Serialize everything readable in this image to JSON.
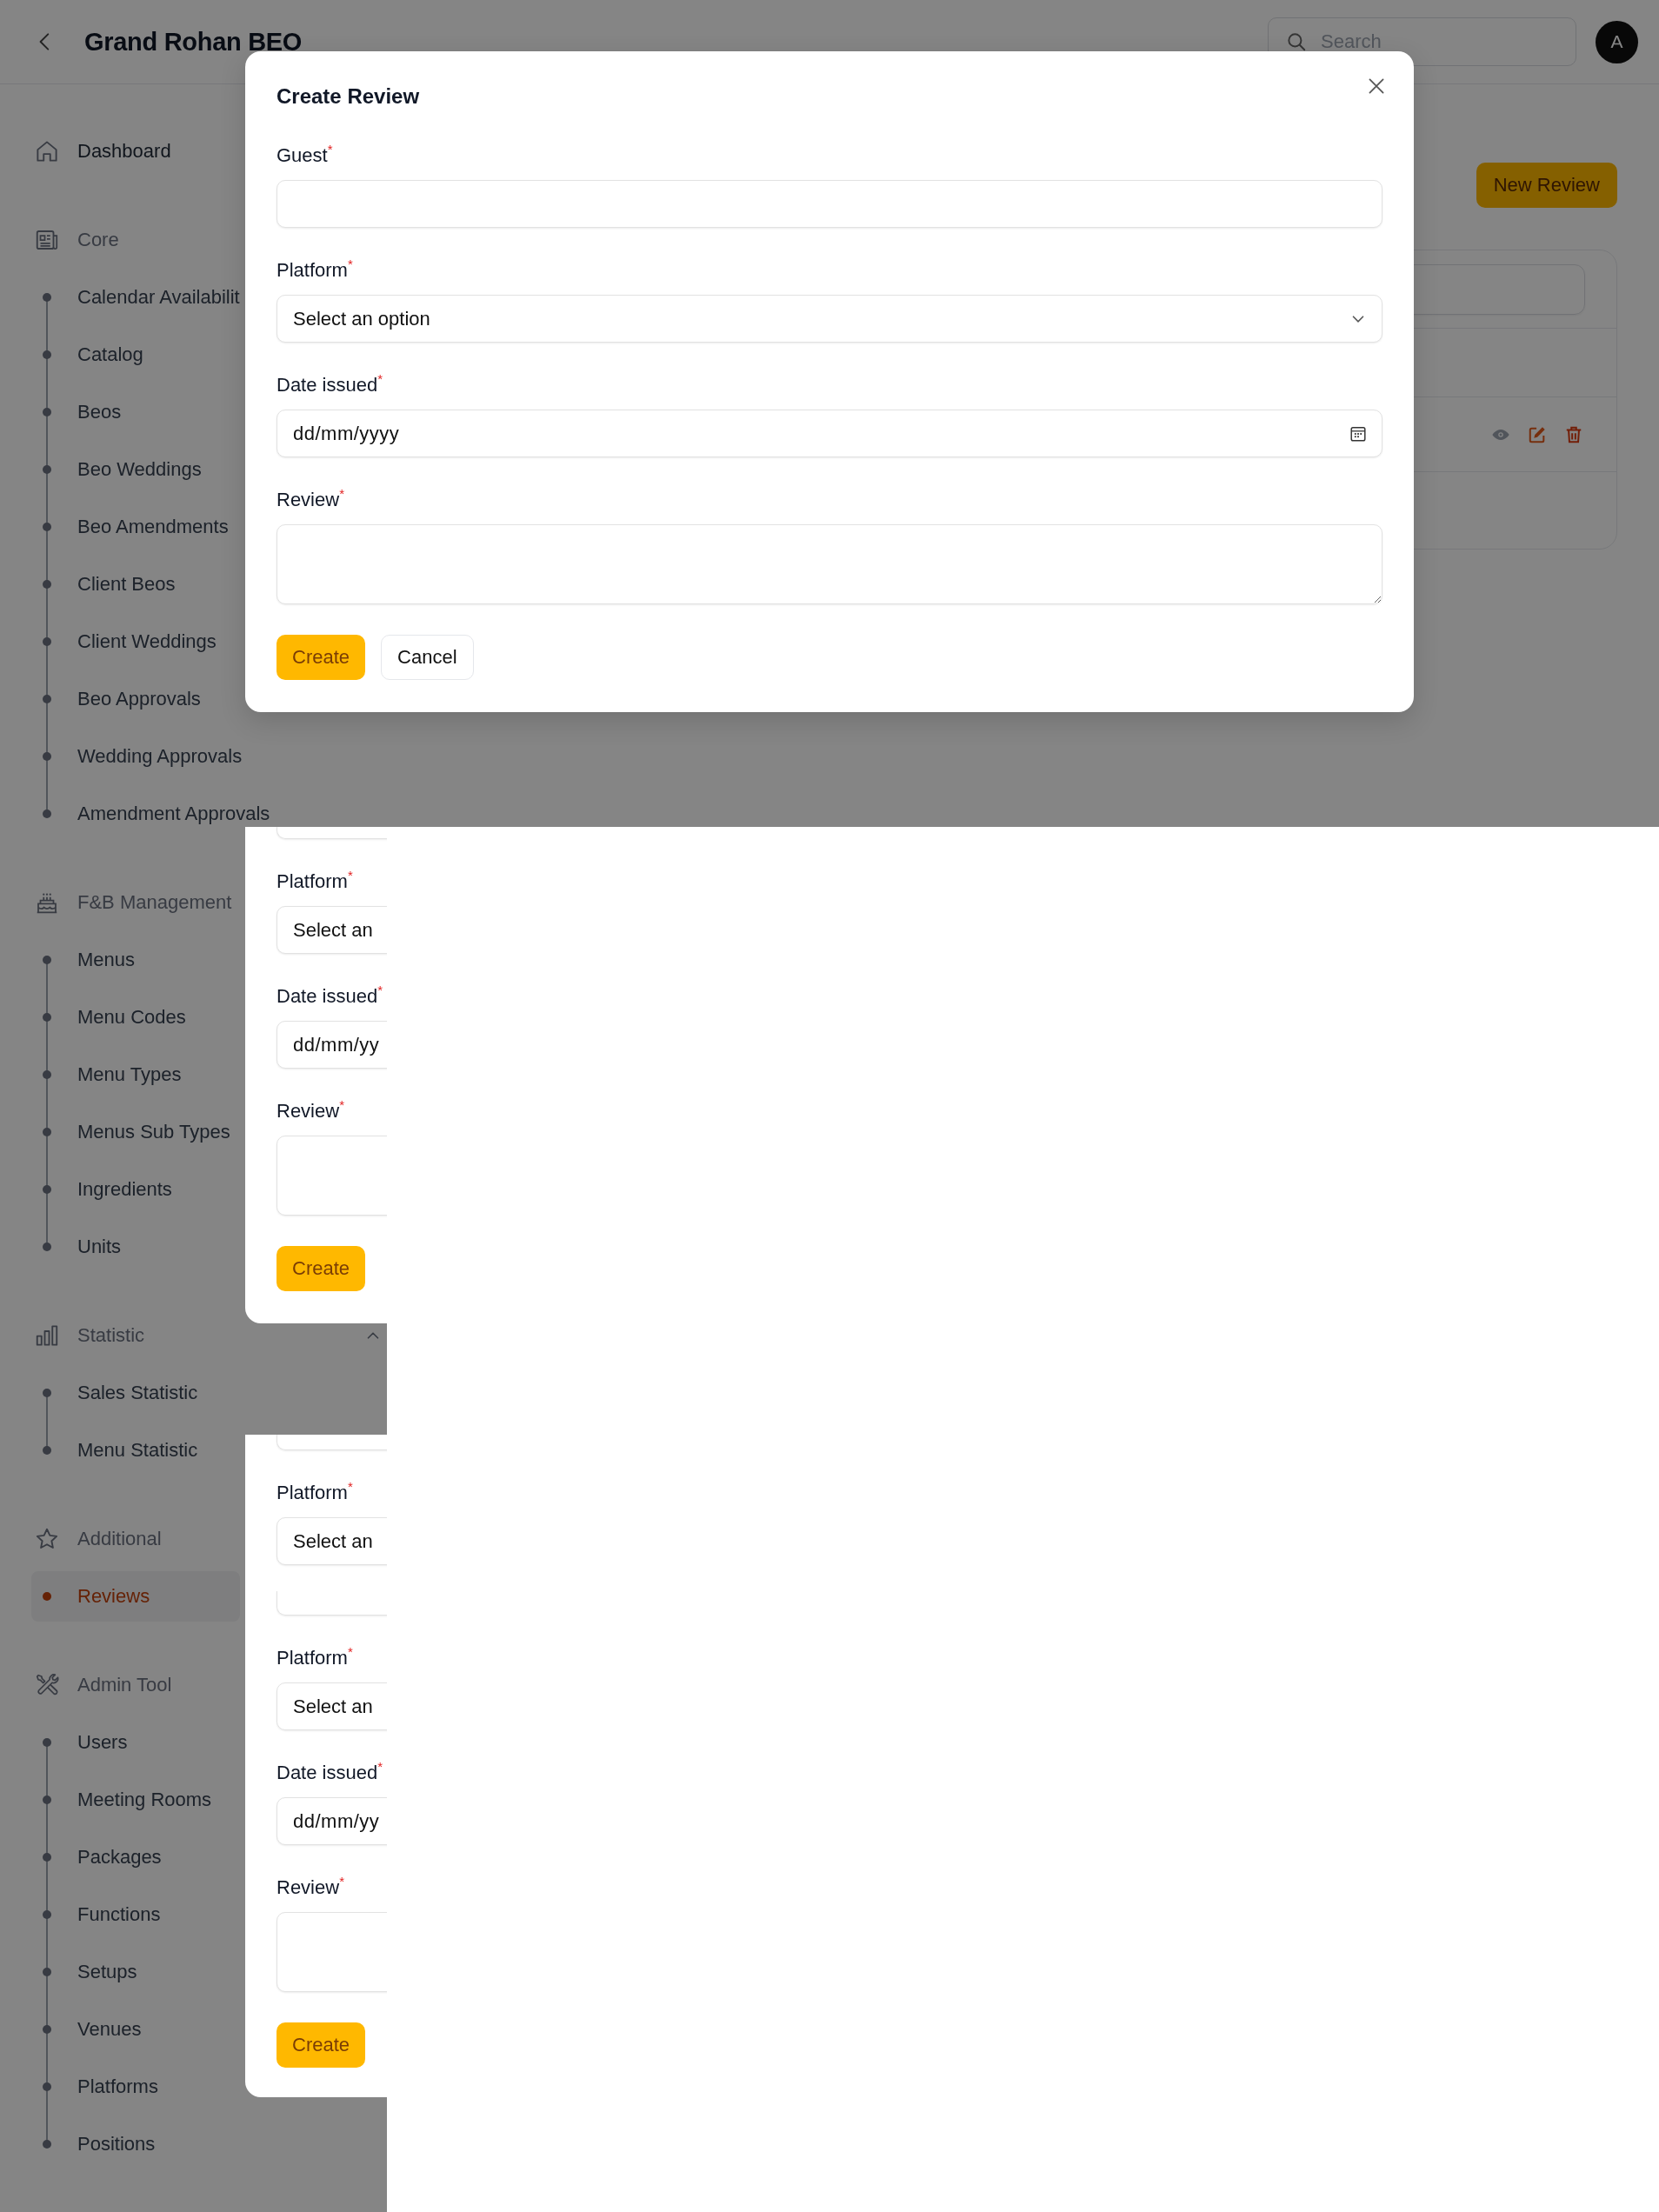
{
  "header": {
    "title": "Grand Rohan BEO",
    "search": {
      "placeholder": "Search"
    },
    "avatar": "A"
  },
  "sidebar": {
    "items": [
      {
        "kind": "link",
        "label": "Dashboard",
        "selected": false
      },
      {
        "kind": "section",
        "label": "Core",
        "children": [
          {
            "label": "Calendar Availabilit",
            "selected": false
          },
          {
            "label": "Catalog",
            "selected": false
          },
          {
            "label": "Beos",
            "selected": false
          },
          {
            "label": "Beo Weddings",
            "selected": false
          },
          {
            "label": "Beo Amendments",
            "selected": false
          },
          {
            "label": "Client Beos",
            "selected": false
          },
          {
            "label": "Client Weddings",
            "selected": false
          },
          {
            "label": "Beo Approvals",
            "selected": false
          },
          {
            "label": "Wedding Approvals",
            "selected": false
          },
          {
            "label": "Amendment Approvals",
            "selected": false
          }
        ]
      },
      {
        "kind": "section",
        "label": "F&B Management",
        "children": [
          {
            "label": "Menus",
            "selected": false
          },
          {
            "label": "Menu Codes",
            "selected": false
          },
          {
            "label": "Menu Types",
            "selected": false
          },
          {
            "label": "Menus Sub Types",
            "selected": false
          },
          {
            "label": "Ingredients",
            "selected": false
          },
          {
            "label": "Units",
            "selected": false
          }
        ]
      },
      {
        "kind": "section",
        "label": "Statistic",
        "expanded": true,
        "children": [
          {
            "label": "Sales Statistic",
            "selected": false
          },
          {
            "label": "Menu Statistic",
            "selected": false
          }
        ]
      },
      {
        "kind": "section",
        "label": "Additional",
        "children": [
          {
            "label": "Reviews",
            "selected": true
          }
        ]
      },
      {
        "kind": "section",
        "label": "Admin Tool",
        "children": [
          {
            "label": "Users",
            "selected": false
          },
          {
            "label": "Meeting Rooms",
            "selected": false
          },
          {
            "label": "Packages",
            "selected": false
          },
          {
            "label": "Functions",
            "selected": false
          },
          {
            "label": "Setups",
            "selected": false
          },
          {
            "label": "Venues",
            "selected": false
          },
          {
            "label": "Platforms",
            "selected": false
          },
          {
            "label": "Positions",
            "selected": false
          }
        ]
      }
    ]
  },
  "page": {
    "new_button": "New Review"
  },
  "modal": {
    "title": "Create Review",
    "fields": [
      {
        "kind": "text",
        "label": "Guest$^{*}$"
      },
      {
        "kind": "select",
        "label": "Platform$^{*}$",
        "placeholder": "Select an option"
      },
      {
        "kind": "date",
        "label": "Date issued$^{*}$",
        "placeholder": "dd/mm/yyyy"
      },
      {
        "kind": "textarea",
        "label": "Review$^{*}$"
      }
    ],
    "buttons": [
      {
        "kind": "primary",
        "label": "Create"
      },
      {
        "kind": "secondary",
        "label": "Cancel"
      }
    ]
  },
  "render_fragments": [
    {
      "fields": [
        {
          "kind": "stub"
        },
        {
          "kind": "select",
          "label": "Platform$^{*}$",
          "placeholder": "Select an"
        },
        {
          "kind": "date",
          "label": "Date issued$^{*}$",
          "placeholder": "dd/mm/yy"
        },
        {
          "kind": "textarea",
          "label": "Review$^{*}$"
        }
      ],
      "buttons": [
        {
          "kind": "primary",
          "label": "Create"
        }
      ]
    },
    {
      "fields": [
        {
          "kind": "stub"
        },
        {
          "kind": "select",
          "label": "Platform$^{*}$",
          "placeholder": "Select an"
        }
      ]
    },
    {
      "fields": [
        {
          "kind": "stub"
        },
        {
          "kind": "select",
          "label": "Platform$^{*}$",
          "placeholder": "Select an"
        },
        {
          "kind": "date",
          "label": "Date issued$^{*}$",
          "placeholder": "dd/mm/yy"
        },
        {
          "kind": "textarea",
          "label": "Review$^{*}$"
        }
      ],
      "buttons": [
        {
          "kind": "primary",
          "label": "Create"
        }
      ]
    }
  ]
}
